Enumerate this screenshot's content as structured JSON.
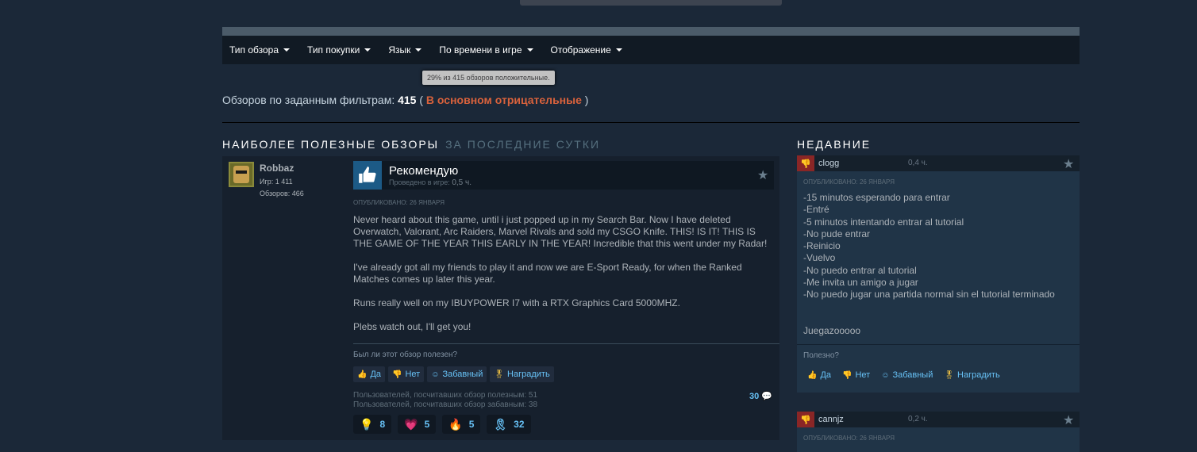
{
  "filters": [
    {
      "label": "Тип обзора"
    },
    {
      "label": "Тип покупки"
    },
    {
      "label": "Язык"
    },
    {
      "label": "По времени в игре"
    },
    {
      "label": "Отображение"
    }
  ],
  "tooltip": "29% из 415 обзоров положительные.",
  "summary": {
    "prefix": "Обзоров по заданным фильтрам:",
    "count": "415",
    "open": "(",
    "rating": "В основном отрицательные",
    "close": ")"
  },
  "main_section": {
    "title": "НАИБОЛЕЕ ПОЛЕЗНЫЕ ОБЗОРЫ",
    "subtitle": "ЗА ПОСЛЕДНИЕ СУТКИ"
  },
  "recent_section": {
    "title": "НЕДАВНИЕ"
  },
  "review": {
    "author": "Robbaz",
    "games": "Игр: 1 411",
    "reviews": "Обзоров: 466",
    "recommendation": "Рекомендую",
    "hours_label": "Проведено в игре:",
    "hours_value": "0,5 ч.",
    "posted": "ОПУБЛИКОВАНО: 26 ЯНВАРЯ",
    "text": "Never heard about this game, until i just popped up in my Search Bar. Now I have deleted Overwatch, Valorant, Arc Raiders, Marvel Rivals and sold my CSGO Knife. THIS! IS IT! THIS IS THE GAME OF THE YEAR THIS EARLY IN THE YEAR! Incredible that this went under my Radar!\n\nI've already got all my friends to play it and now we are E-Sport Ready, for when the Ranked Matches comes up later this year.\n\nRuns really well on my IBUYPOWER I7 with a RTX Graphics Card 5000MHZ.\n\nPlebs watch out, I'll get you!",
    "helpful_question": "Был ли этот обзор полезен?",
    "buttons": {
      "yes": "Да",
      "no": "Нет",
      "funny": "Забавный",
      "award": "Наградить"
    },
    "helpful_count": "Пользователей, посчитавших обзор полезным: 51",
    "funny_count": "Пользователей, посчитавших обзор забавным: 38",
    "comments": "30",
    "awards": [
      {
        "icon": "lightbulb-award-icon",
        "count": "8"
      },
      {
        "icon": "heart-award-icon",
        "count": "5"
      },
      {
        "icon": "fire-award-icon",
        "count": "5"
      },
      {
        "icon": "medal-award-icon",
        "count": "32"
      }
    ]
  },
  "recent_reviews": [
    {
      "user": "clogg",
      "hours": "0,4 ч.",
      "posted": "ОПУБЛИКОВАНО: 26 ЯНВАРЯ",
      "text": "-15 minutos esperando para entrar\n-Entré\n-5 minutos intentando entrar al tutorial\n-No pude entrar\n-Reinicio\n-Vuelvo\n-No puedo entrar al tutorial\n-Me invita un amigo a jugar\n-No puedo jugar una partida normal sin el tutorial terminado\n\n\nJuegazooooo",
      "helpful_question": "Полезно?",
      "buttons": {
        "yes": "Да",
        "no": "Нет",
        "funny": "Забавный",
        "award": "Наградить"
      }
    },
    {
      "user": "cannjz",
      "hours": "0,2 ч.",
      "posted": "ОПУБЛИКОВАНО: 26 ЯНВАРЯ"
    }
  ],
  "colors": {
    "background": "#1b2838",
    "negative": "#d9623c",
    "link": "#67c1f5",
    "thumbs_up": "#1c5a86",
    "thumbs_down": "#8a2626"
  }
}
